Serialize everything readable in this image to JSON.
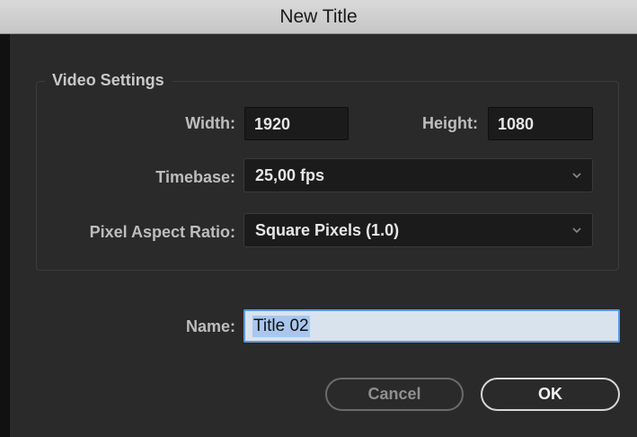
{
  "window": {
    "title": "New Title"
  },
  "video_settings": {
    "legend": "Video Settings",
    "width_label": "Width:",
    "width_value": "1920",
    "height_label": "Height:",
    "height_value": "1080",
    "timebase_label": "Timebase:",
    "timebase_value": "25,00 fps",
    "par_label": "Pixel Aspect Ratio:",
    "par_value": "Square Pixels (1.0)"
  },
  "name": {
    "label": "Name:",
    "value": "Title 02"
  },
  "buttons": {
    "cancel": "Cancel",
    "ok": "OK"
  },
  "icons": {
    "dropdown": "chevron-down-icon"
  },
  "colors": {
    "background": "#2a2a2a",
    "titlebar": "#cfcfcf",
    "field_bg": "#1b1b1b",
    "selection": "#a9c7ee",
    "focus_ring": "#5a9adf"
  }
}
